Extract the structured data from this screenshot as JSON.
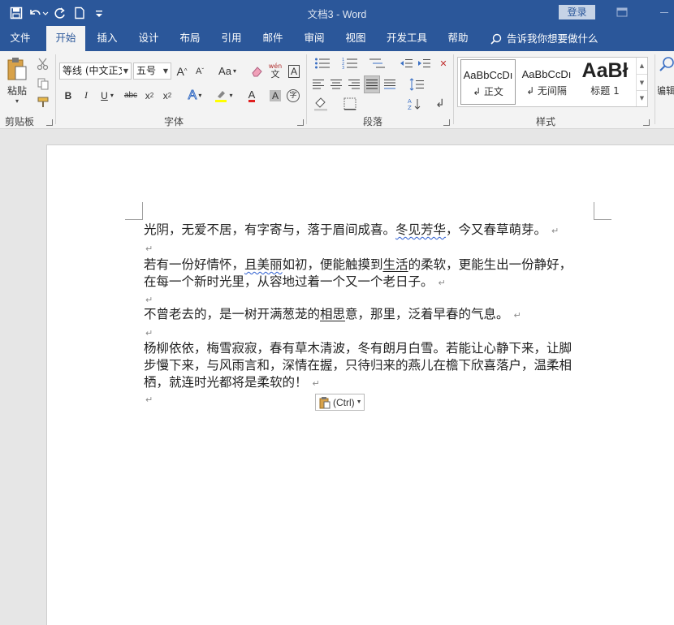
{
  "app": {
    "title": "文档3  -  Word",
    "login_label": "登录"
  },
  "tabs": [
    {
      "label": "文件"
    },
    {
      "label": "开始"
    },
    {
      "label": "插入"
    },
    {
      "label": "设计"
    },
    {
      "label": "布局"
    },
    {
      "label": "引用"
    },
    {
      "label": "邮件"
    },
    {
      "label": "审阅"
    },
    {
      "label": "视图"
    },
    {
      "label": "开发工具"
    },
    {
      "label": "帮助"
    }
  ],
  "tell_me": "告诉我你想要做什么",
  "ribbon": {
    "clipboard": {
      "paste_label": "粘贴",
      "group_label": "剪贴板"
    },
    "font": {
      "font_name": "等线 (中文正文",
      "font_size": "五号",
      "group_label": "字体",
      "change_case": "Aa",
      "phonetic": "wén",
      "phonetic_char": "文"
    },
    "paragraph": {
      "group_label": "段落"
    },
    "styles": {
      "group_label": "样式",
      "items": [
        {
          "sample": "AaBbCcDı",
          "name": "↲ 正文"
        },
        {
          "sample": "AaBbCcDı",
          "name": "↲ 无间隔"
        },
        {
          "sample": "AaBł",
          "name": "标题 1"
        }
      ]
    },
    "editing": {
      "label": "编辑"
    }
  },
  "document": {
    "paragraphs": [
      {
        "pre": "光阴，无爱不居，有字寄与，落于眉间成喜。",
        "squig": "冬见芳华",
        "post": "，今又春草萌芽。"
      },
      {
        "pre": "若有一份好情怀，",
        "squig": "且美丽",
        "mid": "如初，便能触摸到",
        "ul": "生活",
        "post": "的柔软，更能生出一份静好，"
      },
      {
        "line": "在每一个新时光里，从容地过着一个又一个老日子。"
      },
      {
        "pre": "不曾老去的，是一树开满葱茏的",
        "ul": "相思",
        "post": "意，那里，泛着早春的气息。"
      },
      {
        "line": "杨柳依依，梅雪寂寂，春有草木清波，冬有朗月白雪。若能让心静下来，让脚"
      },
      {
        "line": "步慢下来，与风雨言和，深情在握，只待归来的燕儿在檐下欣喜落户，温柔相"
      },
      {
        "line": "栖，就连时光都将是柔软的！"
      }
    ],
    "para_mark": "↵",
    "paste_options": "(Ctrl)"
  }
}
